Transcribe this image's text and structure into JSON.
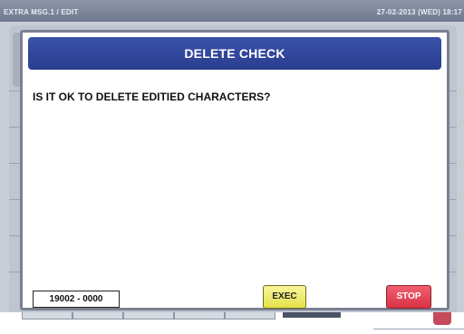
{
  "topbar": {
    "title": "EXTRA MSG.1 / EDIT",
    "datetime": "27-02-2013 (WED) 18:17"
  },
  "dialog": {
    "title": "DELETE CHECK",
    "message": "IS IT OK TO DELETE EDITIED CHARACTERS?",
    "code": "19002 - 0000",
    "exec_label": "EXEC",
    "stop_label": "STOP"
  },
  "colors": {
    "header_blue": "#2f46a0",
    "exec_yellow": "#eeec6a",
    "stop_red": "#e24556"
  }
}
